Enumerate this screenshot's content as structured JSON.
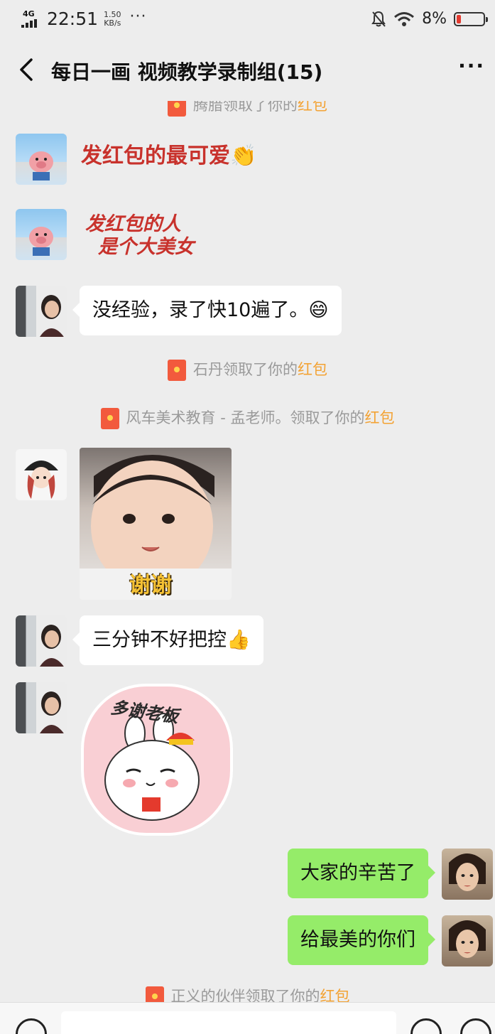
{
  "status_bar": {
    "network": "4G",
    "time": "22:51",
    "speed_value": "1.50",
    "speed_unit": "KB/s",
    "more": "···",
    "battery_percent": "8%",
    "battery_color": "#e23a2f"
  },
  "header": {
    "back_icon": "chevron-left-icon",
    "title": "每日一画 视频教学录制组(15)",
    "more_label": "···"
  },
  "messages": [
    {
      "type": "system",
      "prefix": "腾腊领取了你的",
      "link": "红包"
    },
    {
      "type": "sticker",
      "side": "left",
      "text": "发红包的最可爱",
      "emoji": "👏"
    },
    {
      "type": "sticker",
      "side": "left",
      "line1": "发红包的人",
      "line2": "是个大美女"
    },
    {
      "type": "text",
      "side": "left",
      "text": "没经验，录了快10遍了。",
      "emoji": "😄"
    },
    {
      "type": "system",
      "prefix": "石丹领取了你的",
      "link": "红包"
    },
    {
      "type": "system",
      "prefix": "风车美术教育 - 孟老师。领取了你的",
      "link": "红包"
    },
    {
      "type": "image",
      "side": "left",
      "caption": "谢谢"
    },
    {
      "type": "text",
      "side": "left",
      "text": "三分钟不好把控",
      "emoji": "👍"
    },
    {
      "type": "sticker",
      "side": "left",
      "text": "多谢老板"
    },
    {
      "type": "text",
      "side": "right",
      "text": "大家的辛苦了"
    },
    {
      "type": "text",
      "side": "right",
      "text": "给最美的你们"
    },
    {
      "type": "system",
      "prefix": "正义的伙伴领取了你的",
      "link": "红包"
    }
  ],
  "colors": {
    "background": "#ededed",
    "bubble_in": "#ffffff",
    "bubble_out": "#95ec69",
    "red_packet_link": "#f3a233",
    "system_text": "#9a9a9a"
  },
  "input_bar": {
    "voice_icon": "voice-icon",
    "emoji_icon": "emoji-icon",
    "add_icon": "plus-icon"
  }
}
